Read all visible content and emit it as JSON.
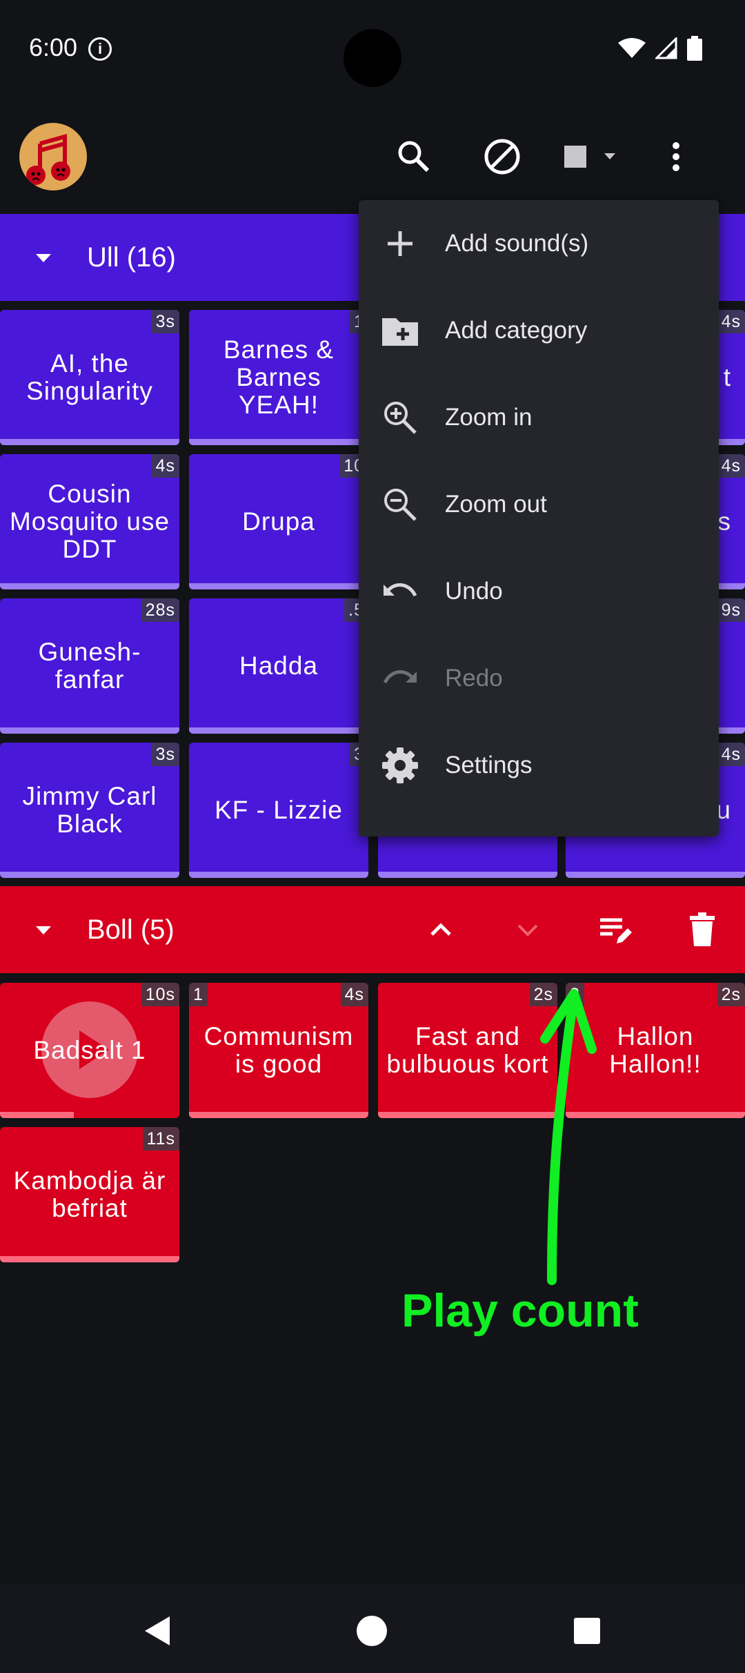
{
  "status_bar": {
    "time": "6:00"
  },
  "toolbar": {
    "logo": "sad-music-notes-logo",
    "search_icon": "search-icon",
    "block_icon": "block-icon",
    "stop_icon": "stop-icon",
    "more_icon": "more-vert-icon"
  },
  "categories": [
    {
      "title": "Ull (16)",
      "color": "#4a18d8",
      "tiles": [
        {
          "name": "AI, the Singularity",
          "duration": "3s"
        },
        {
          "name": "Barnes & Barnes YEAH!",
          "duration": "1"
        },
        {
          "name": "",
          "duration": ""
        },
        {
          "name": "t",
          "duration": "4s"
        },
        {
          "name": "Cousin Mosquito use DDT",
          "duration": "4s"
        },
        {
          "name": "Drupa",
          "duration": "10"
        },
        {
          "name": "",
          "duration": ""
        },
        {
          "name": "s",
          "duration": "4s"
        },
        {
          "name": "Gunesh-fanfar",
          "duration": "28s"
        },
        {
          "name": "Hadda",
          "duration": ".5"
        },
        {
          "name": "",
          "duration": ""
        },
        {
          "name": "",
          "duration": "9s"
        },
        {
          "name": "Jimmy Carl Black",
          "duration": "3s"
        },
        {
          "name": "KF - Lizzie",
          "duration": "3"
        },
        {
          "name": "",
          "duration": ""
        },
        {
          "name": "u",
          "duration": "4s"
        }
      ]
    },
    {
      "title": "Boll (5)",
      "color": "#d8001e",
      "tiles": [
        {
          "name": "Badsalt 1",
          "duration": "10s",
          "playing": true,
          "progress": 0.41
        },
        {
          "name": "Communism is good",
          "duration": "4s",
          "play_count": "1"
        },
        {
          "name": "Fast and bulbuous kort",
          "duration": "2s"
        },
        {
          "name": "Hallon Hallon!!",
          "duration": "2s",
          "play_count": "2"
        },
        {
          "name": "Kambodja är befriat",
          "duration": "11s"
        }
      ]
    }
  ],
  "menu": {
    "items": [
      {
        "label": "Add sound(s)",
        "icon": "plus-icon",
        "enabled": true
      },
      {
        "label": "Add category",
        "icon": "folder-add-icon",
        "enabled": true
      },
      {
        "label": "Zoom in",
        "icon": "zoom-in-icon",
        "enabled": true
      },
      {
        "label": "Zoom out",
        "icon": "zoom-out-icon",
        "enabled": true
      },
      {
        "label": "Undo",
        "icon": "undo-icon",
        "enabled": true
      },
      {
        "label": "Redo",
        "icon": "redo-icon",
        "enabled": false
      },
      {
        "label": "Settings",
        "icon": "gear-icon",
        "enabled": true
      }
    ]
  },
  "annotation": {
    "text": "Play count",
    "color": "#11ee22"
  }
}
